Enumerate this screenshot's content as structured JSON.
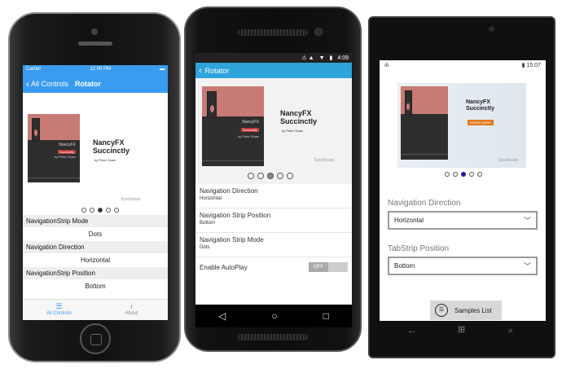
{
  "ios": {
    "status_carrier": "Carrier",
    "status_time": "12:00 PM",
    "back_label": "All Controls",
    "title": "Rotator",
    "book": {
      "title_line1": "NancyFX",
      "title_line2": "Succinctly",
      "author": "by Peter Shaw",
      "cover_title": "NancyFX",
      "cover_badge": "Succinctly",
      "cover_author": "by Peter Shaw"
    },
    "logo": "Syncfusion",
    "rows": [
      {
        "label": "NavigationStrip Mode",
        "value": "Dots"
      },
      {
        "label": "Navigation Direction",
        "value": "Horizontal"
      },
      {
        "label": "NavigationStrip Position",
        "value": "Bottom"
      }
    ],
    "tabs": [
      {
        "label": "All Controls",
        "icon": "list-icon"
      },
      {
        "label": "About",
        "icon": "info-icon"
      }
    ]
  },
  "android": {
    "status_time": "4:09",
    "title": "Rotator",
    "book": {
      "title_line1": "NancyFX",
      "title_line2": "Succinctly",
      "author": "by Peter Shaw",
      "cover_title": "NancyFX",
      "cover_badge": "Succinctly",
      "cover_author": "by Peter Shaw"
    },
    "logo": "Syncfusion",
    "items": [
      {
        "label": "Navigation Direction",
        "value": "Horizontal"
      },
      {
        "label": "Navigation Strip Position",
        "value": "Bottom"
      },
      {
        "label": "Navigation Strip Mode",
        "value": "Dots"
      }
    ],
    "autoplay": {
      "label": "Enable AutoPlay",
      "state": "OFF"
    }
  },
  "windows": {
    "status_time": "15:07",
    "book": {
      "title_line1": "NancyFX",
      "title_line2": "Succinctly",
      "button": "KNOW MORE"
    },
    "logo": "Syncfusion",
    "direction_label": "Navigation Direction",
    "direction_value": "Horizontal",
    "tab_label": "TabStrip Position",
    "tab_value": "Bottom",
    "samples_label": "Samples List"
  },
  "colors": {
    "ios_blue": "#3a9cf0",
    "android_blue": "#2fa3db",
    "book_red": "#c87a74"
  }
}
